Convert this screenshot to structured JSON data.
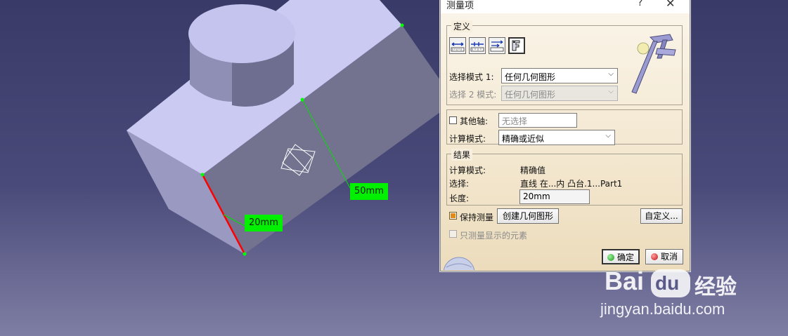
{
  "viewport": {
    "dimension_labels": [
      "20mm",
      "50mm"
    ]
  },
  "dialog": {
    "title": "测量项",
    "help_glyph": "?",
    "close_glyph": "✕",
    "definition": {
      "legend": "定义",
      "mode_icons": [
        "measure-between-icon",
        "measure-chain-icon",
        "measure-fan-icon",
        "measure-item-icon"
      ],
      "select_mode_1": {
        "label": "选择模式 1:",
        "value": "任何几何图形"
      },
      "select_mode_2": {
        "label": "选择 2 模式:",
        "value": "任何几何图形"
      },
      "other_axis": {
        "label": "其他轴:",
        "placeholder": "无选择"
      },
      "calc_mode": {
        "label": "计算模式:",
        "value": "精确或近似"
      }
    },
    "result": {
      "legend": "结果",
      "calc_mode_label": "计算模式:",
      "calc_mode_value": "精确值",
      "selection_label": "选择:",
      "selection_value": "直线 在...内 凸台.1...Part1",
      "length_label": "长度:",
      "length_value": "20mm"
    },
    "keep_measure_label": "保持测量",
    "create_geometry_label": "创建几何图形",
    "customize_label": "自定义...",
    "only_visible_label": "只测量显示的元素",
    "ok_label": "确定",
    "cancel_label": "取消"
  },
  "watermark": {
    "brand_left": "Bai",
    "brand_mid": "du",
    "brand_right": "经验",
    "url": "jingyan.baidu.com"
  },
  "colors": {
    "background_top": "#3a3a68",
    "part_top_face": "#c8c8f0",
    "part_front_face": "#7a7a98",
    "dimension_green": "#00f000",
    "selected_edge": "#ff0000"
  }
}
